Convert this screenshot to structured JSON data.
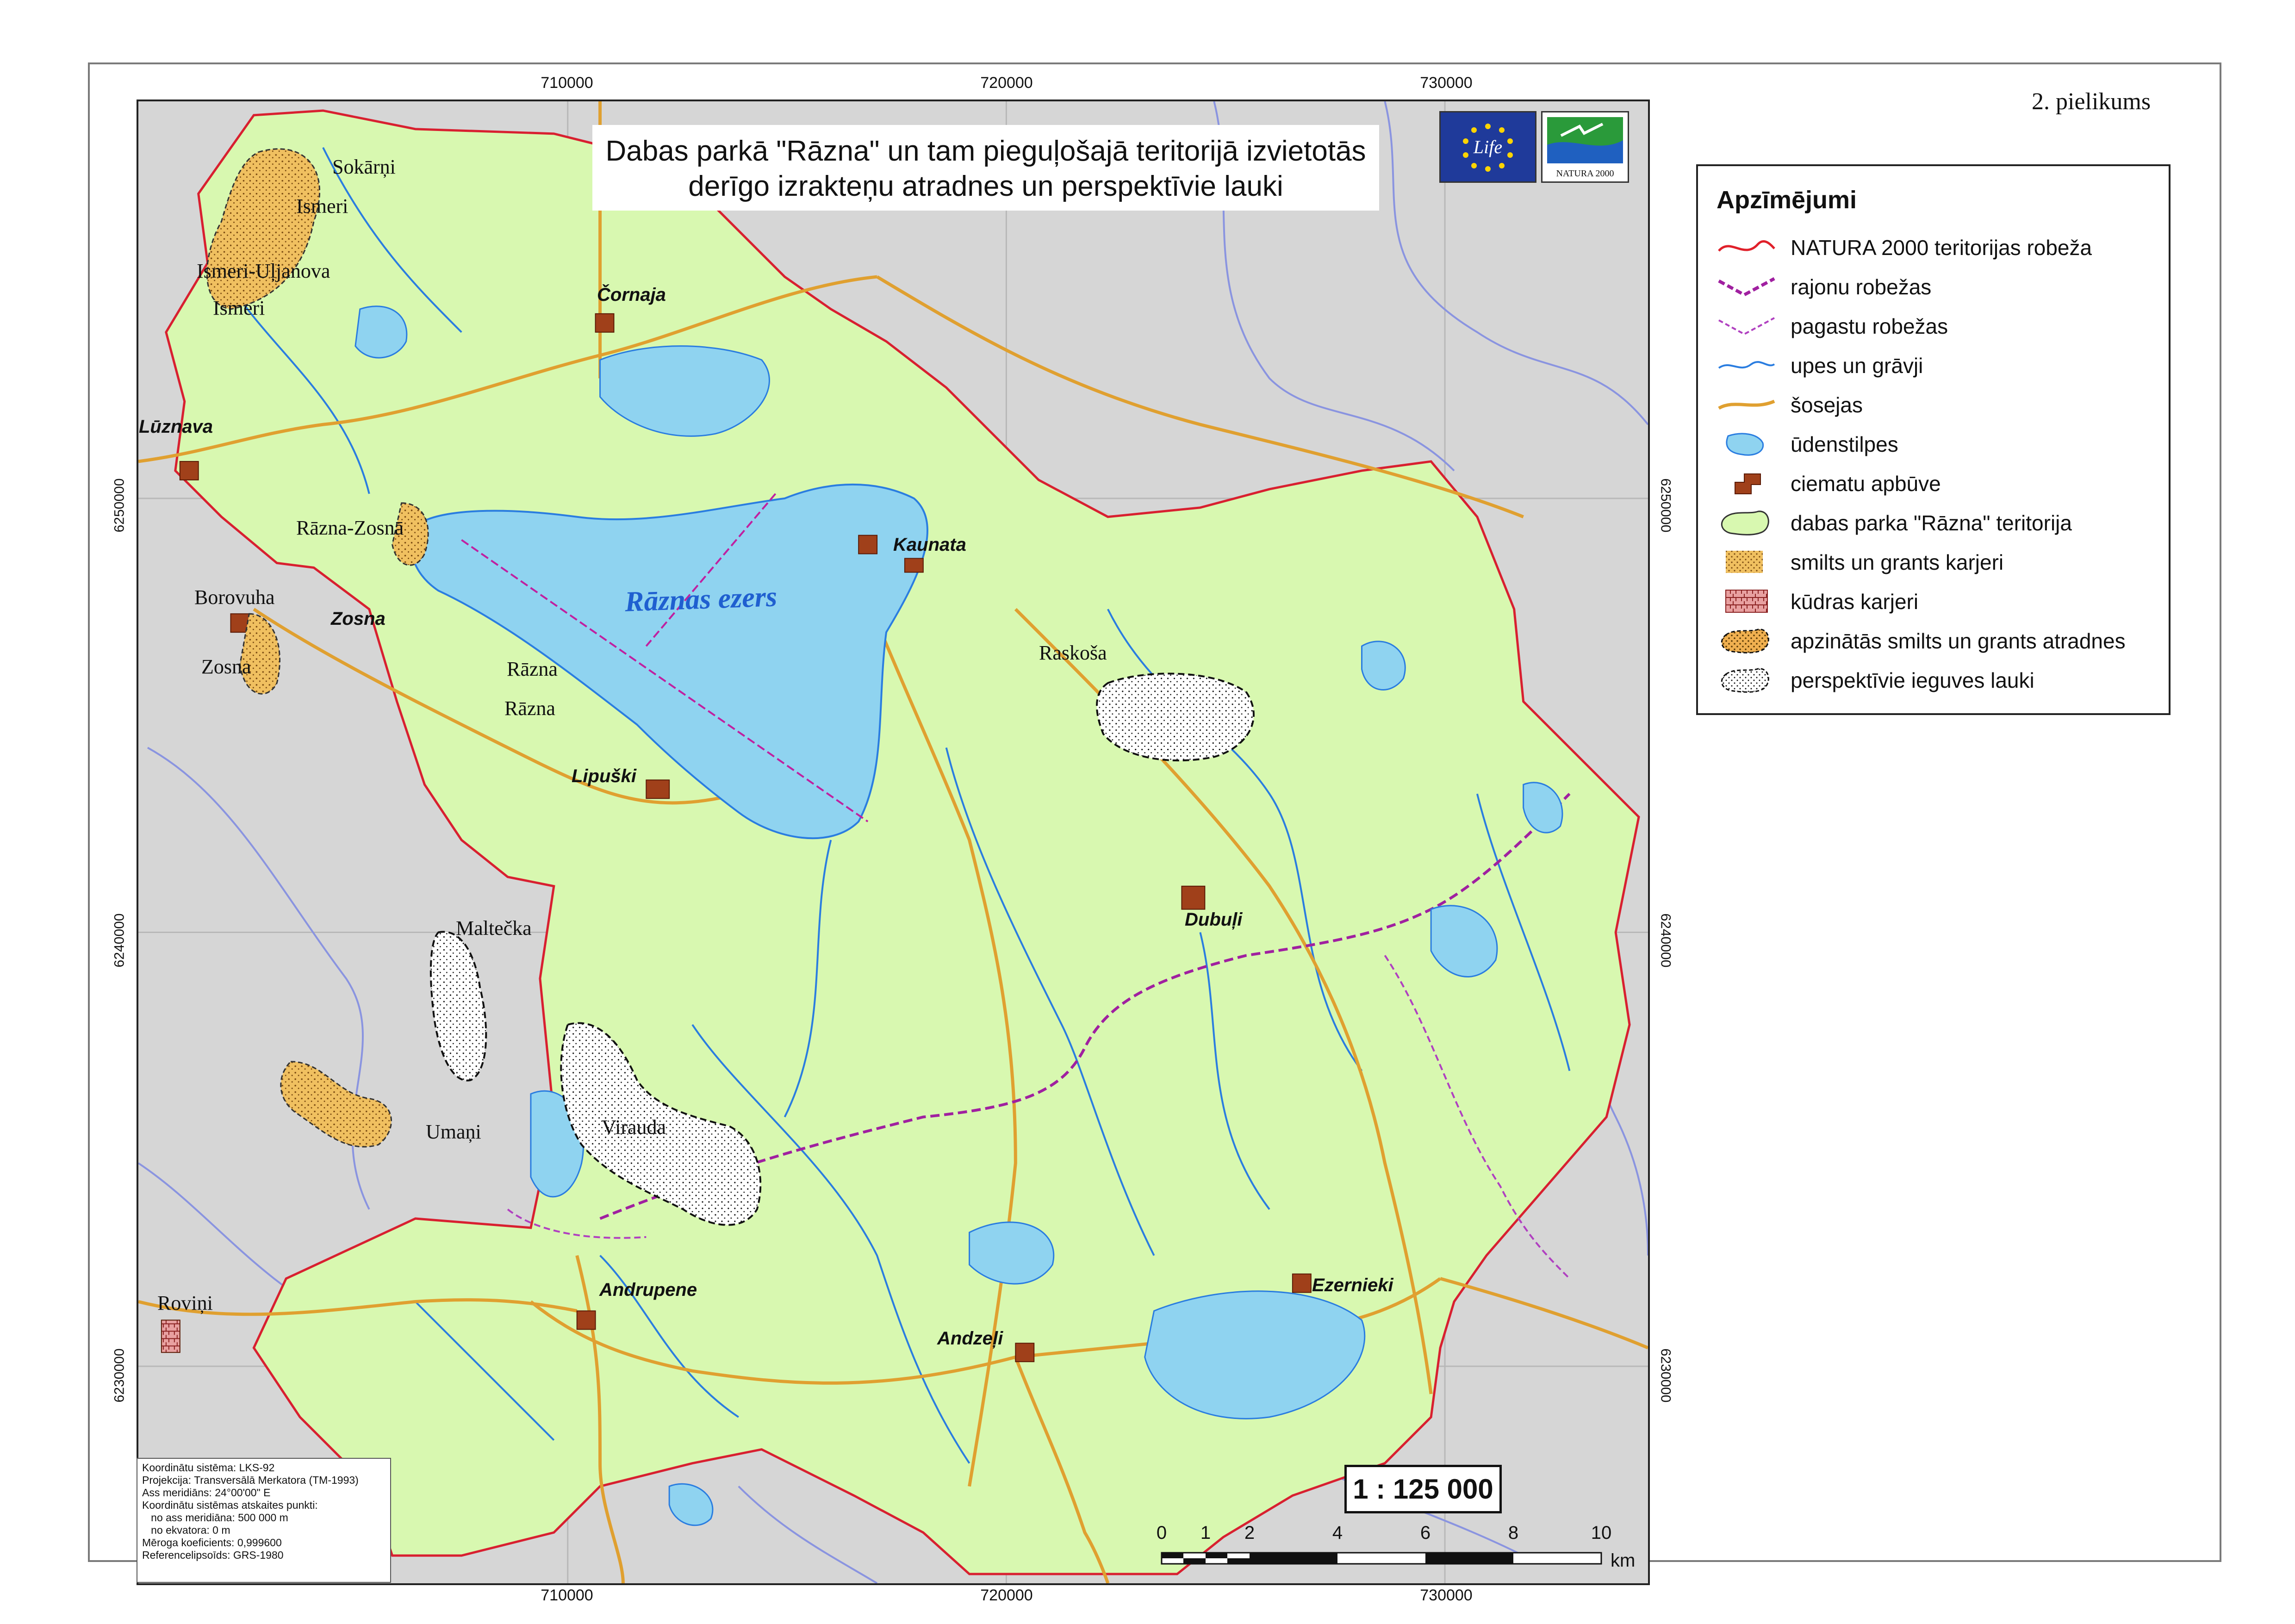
{
  "sheet_label": "2. pielikums",
  "title": {
    "line1": "Dabas parkā \"Rāzna\"  un tam pieguļošajā teritorijā izvietotās",
    "line2": "derīgo izrakteņu atradnes un perspektīvie lauki"
  },
  "logos": {
    "life": "Life",
    "natura": "NATURA 2000"
  },
  "coordinates": {
    "top": [
      "710000",
      "720000",
      "730000"
    ],
    "bottom": [
      "710000",
      "720000",
      "730000"
    ],
    "left": [
      "6250000",
      "6240000",
      "6230000"
    ],
    "right": [
      "6250000",
      "6240000",
      "6230000"
    ]
  },
  "legend": {
    "title": "Apzīmējumi",
    "items": [
      {
        "label": "NATURA 2000 teritorijas robeža",
        "symbol": "natura-boundary-line",
        "color": "#e0202a"
      },
      {
        "label": "rajonu robežas",
        "symbol": "district-boundary-line",
        "color": "#a020a0"
      },
      {
        "label": "pagastu robežas",
        "symbol": "parish-boundary-line",
        "color": "#b040c0"
      },
      {
        "label": "upes un grāvji",
        "symbol": "river-line",
        "color": "#2a7de0"
      },
      {
        "label": "šosejas",
        "symbol": "road-line",
        "color": "#e0a030"
      },
      {
        "label": "ūdenstilpes",
        "symbol": "water-patch",
        "color": "#8fd3f0"
      },
      {
        "label": "ciematu apbūve",
        "symbol": "settlement-patch",
        "color": "#a0401a"
      },
      {
        "label": "dabas parka \"Rāzna\" teritorija",
        "symbol": "park-patch",
        "color": "#d8f8b0"
      },
      {
        "label": "smilts un grants karjeri",
        "symbol": "sand-pit-patch",
        "color": "#f0c060"
      },
      {
        "label": "kūdras karjeri",
        "symbol": "peat-pit-patch",
        "color": "#e08080"
      },
      {
        "label": "apzinātās smilts un grants atradnes",
        "symbol": "known-deposit-patch",
        "color": "#f0b050"
      },
      {
        "label": "perspektīvie ieguves lauki",
        "symbol": "prospective-field-patch",
        "color": "#ffffff"
      }
    ]
  },
  "place_names": [
    "Sokārņi",
    "Ismeri",
    "Ismeri-Uļjanova",
    "Ismeri",
    "Rāzna-Zosnā",
    "Borovuha",
    "Zosna",
    "Rāzna",
    "Rāzna",
    "Raskoša",
    "Maltečka",
    "Umaņi",
    "Virauda",
    "Roviņi"
  ],
  "villages": [
    "Čornaja",
    "Lūznava",
    "Kaunata",
    "Zosna",
    "Lipuški",
    "Dubuļi",
    "Andrupene",
    "Ezernieki",
    "Andzeļi"
  ],
  "lake_name": "Rāznas ezers",
  "info_box": [
    "Koordinātu sistēma: LKS-92",
    "Projekcija: Transversālā Merkatora (TM-1993)",
    "Ass meridiāns: 24°00'00\" E",
    "Koordinātu sistēmas atskaites punkti:",
    "   no ass meridiāna: 500 000 m",
    "   no ekvatora: 0 m",
    "Mēroga koeficients: 0,999600",
    "Referencelipsoīds: GRS-1980"
  ],
  "scale": {
    "ratio": "1 : 125 000",
    "ticks": [
      "0",
      "1",
      "2",
      "4",
      "6",
      "8",
      "10"
    ],
    "unit": "km"
  }
}
